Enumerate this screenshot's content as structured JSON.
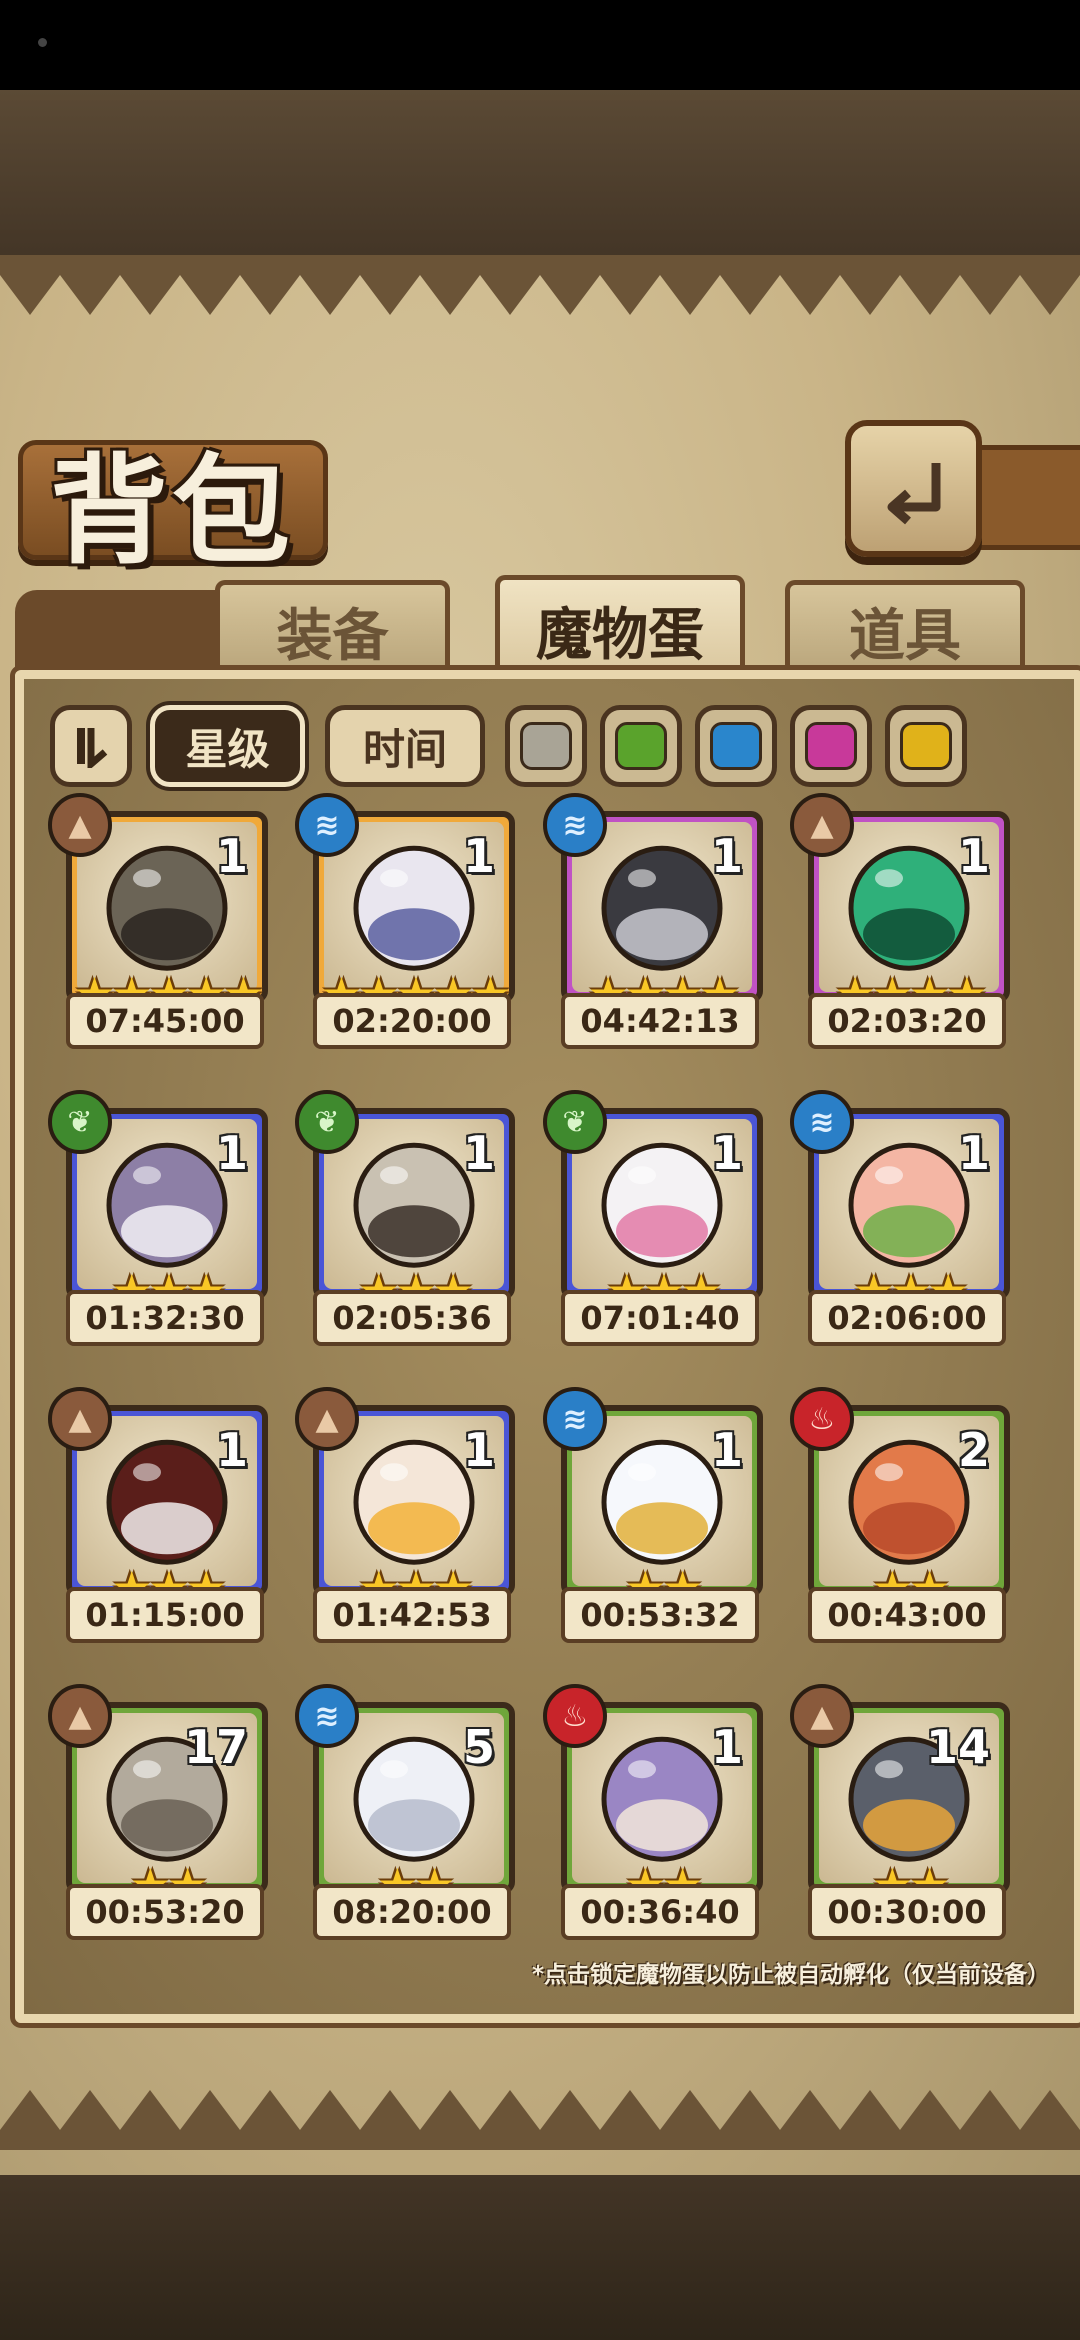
{
  "header": {
    "title": "背包",
    "back_icon": "back-arrow-icon"
  },
  "tabs": [
    {
      "label": "装备",
      "active": false
    },
    {
      "label": "魔物蛋",
      "active": true
    },
    {
      "label": "道具",
      "active": false
    }
  ],
  "filters": {
    "sort_icon": "sort-icon",
    "star_label": "星级",
    "time_label": "时间",
    "color_swatches": [
      "#a9a496",
      "#5aa32c",
      "#2a86cc",
      "#c8399a",
      "#e0b21a"
    ]
  },
  "eggs": [
    {
      "element": "earth",
      "frame": "gold",
      "count": "1",
      "stars": 5,
      "timer": "07:45:00"
    },
    {
      "element": "water",
      "frame": "gold",
      "count": "1",
      "stars": 5,
      "timer": "02:20:00"
    },
    {
      "element": "water",
      "frame": "purple",
      "count": "1",
      "stars": 4,
      "timer": "04:42:13"
    },
    {
      "element": "earth",
      "frame": "purple",
      "count": "1",
      "stars": 4,
      "timer": "02:03:20"
    },
    {
      "element": "nature",
      "frame": "blue",
      "count": "1",
      "stars": 3,
      "timer": "01:32:30"
    },
    {
      "element": "nature",
      "frame": "blue",
      "count": "1",
      "stars": 3,
      "timer": "02:05:36"
    },
    {
      "element": "nature",
      "frame": "blue",
      "count": "1",
      "stars": 3,
      "timer": "07:01:40"
    },
    {
      "element": "water",
      "frame": "blue",
      "count": "1",
      "stars": 3,
      "timer": "02:06:00"
    },
    {
      "element": "earth",
      "frame": "blue",
      "count": "1",
      "stars": 3,
      "timer": "01:15:00"
    },
    {
      "element": "earth",
      "frame": "blue",
      "count": "1",
      "stars": 3,
      "timer": "01:42:53"
    },
    {
      "element": "water",
      "frame": "green",
      "count": "1",
      "stars": 2,
      "timer": "00:53:32"
    },
    {
      "element": "fire",
      "frame": "green",
      "count": "2",
      "stars": 2,
      "timer": "00:43:00"
    },
    {
      "element": "earth",
      "frame": "green",
      "count": "17",
      "stars": 2,
      "timer": "00:53:20"
    },
    {
      "element": "water",
      "frame": "green",
      "count": "5",
      "stars": 2,
      "timer": "08:20:00"
    },
    {
      "element": "fire",
      "frame": "green",
      "count": "1",
      "stars": 2,
      "timer": "00:36:40"
    },
    {
      "element": "earth",
      "frame": "green",
      "count": "14",
      "stars": 2,
      "timer": "00:30:00"
    }
  ],
  "hint": "*点击锁定魔物蛋以防止被自动孵化（仅当前设备）"
}
